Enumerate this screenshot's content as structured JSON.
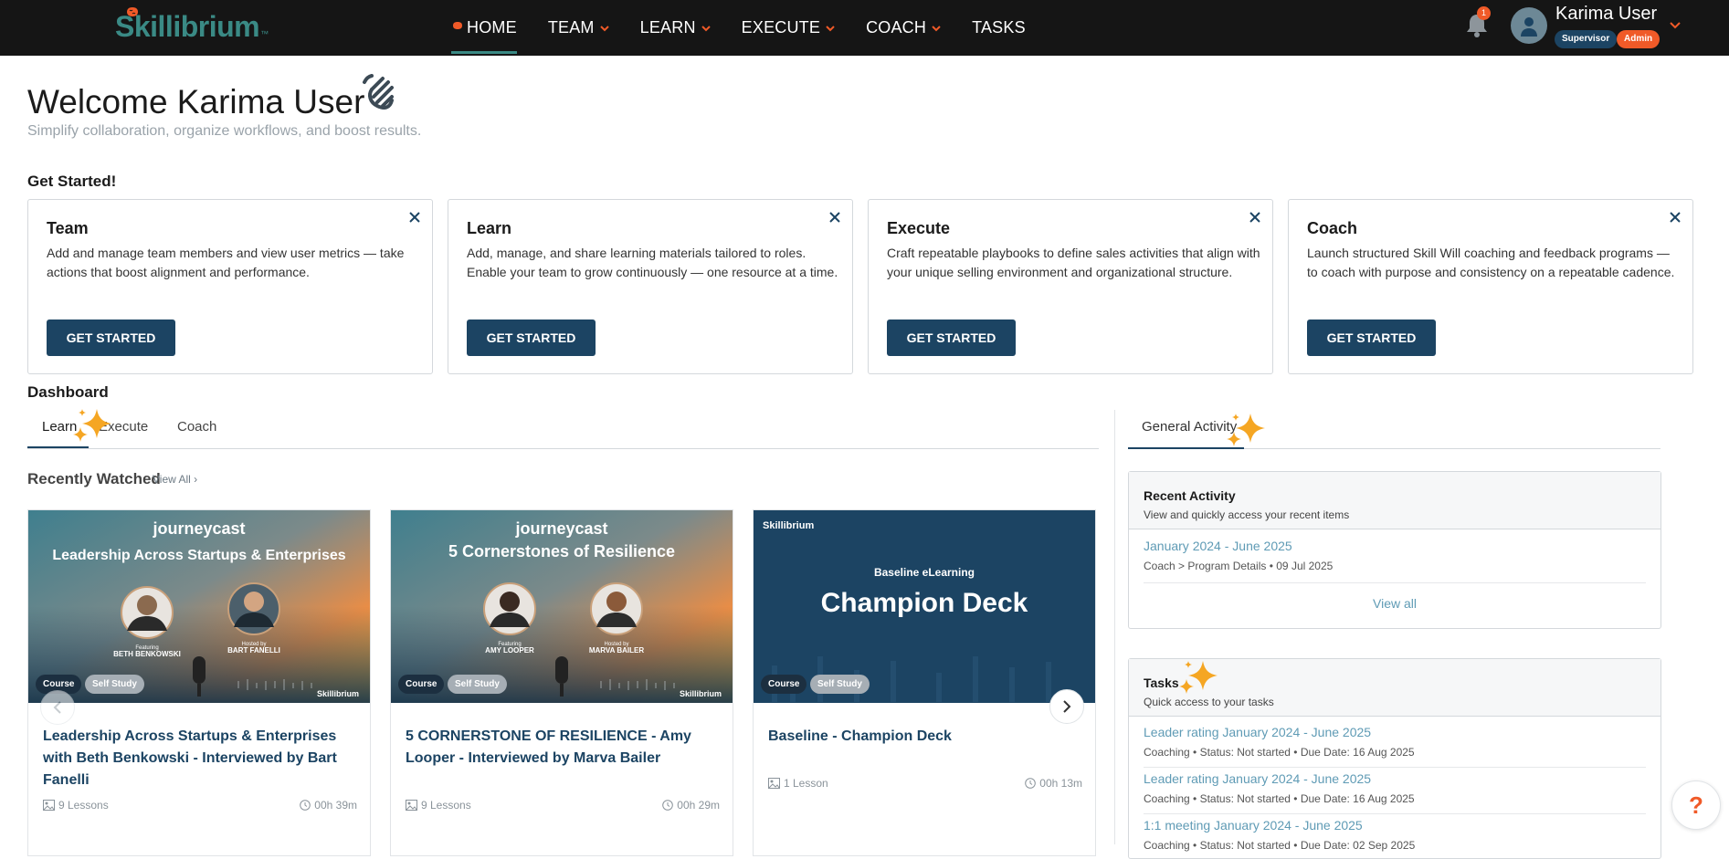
{
  "header": {
    "logo_text": "Skillibrium",
    "logo_tm": "™",
    "nav": [
      {
        "label": "HOME"
      },
      {
        "label": "TEAM"
      },
      {
        "label": "LEARN"
      },
      {
        "label": "EXECUTE"
      },
      {
        "label": "COACH"
      },
      {
        "label": "TASKS"
      }
    ],
    "notification_count": "1",
    "user_name": "Karima User",
    "roles": [
      "Supervisor",
      "Admin"
    ]
  },
  "welcome": {
    "title": "Welcome Karima User",
    "subtitle": "Simplify collaboration, organize workflows, and boost results."
  },
  "get_started": {
    "title": "Get Started!",
    "cards": [
      {
        "title": "Team",
        "text": "Add and manage team members and view user metrics —  take actions that boost alignment and performance.",
        "button": "GET STARTED"
      },
      {
        "title": "Learn",
        "text": "Add, manage, and share learning materials tailored to roles. Enable your team to grow continuously — one resource at a time.",
        "button": "GET STARTED"
      },
      {
        "title": "Execute",
        "text": "Craft repeatable playbooks to define sales activities that align with your unique selling environment and organizational structure.",
        "button": "GET STARTED"
      },
      {
        "title": "Coach",
        "text": "Launch structured Skill Will coaching and feedback programs — to coach with purpose and consistency on a repeatable cadence.",
        "button": "GET STARTED"
      }
    ]
  },
  "dashboard": {
    "title": "Dashboard",
    "tabs": [
      {
        "label": "Learn"
      },
      {
        "label": "Execute"
      },
      {
        "label": "Coach"
      }
    ],
    "recently_watched": {
      "title": "Recently Watched",
      "view_all": "View All"
    },
    "courses": [
      {
        "thumb_brand": "journeycast",
        "thumb_title": "Leadership Across Startups & Enterprises",
        "featuring_label": "Featuring",
        "featuring_name": "BETH BENKOWSKI",
        "hosted_label": "Hosted by",
        "hosted_name": "BART FANELLI",
        "watermark": "Skillibrium",
        "pills": [
          "Course",
          "Self Study"
        ],
        "title": "Leadership Across Startups & Enterprises with Beth Benkowski - Interviewed by Bart Fanelli",
        "lessons": "9 Lessons",
        "duration": "00h 39m"
      },
      {
        "thumb_brand": "journeycast",
        "thumb_title": "5 Cornerstones of Resilience",
        "featuring_label": "Featuring",
        "featuring_name": "AMY LOOPER",
        "hosted_label": "Hosted by",
        "hosted_name": "MARVA BAILER",
        "watermark": "Skillibrium",
        "pills": [
          "Course",
          "Self Study"
        ],
        "title": "5 CORNERSTONE OF RESILIENCE - Amy Looper - Interviewed by Marva Bailer",
        "lessons": "9 Lessons",
        "duration": "00h 29m"
      },
      {
        "thumb_brand": "Skillibrium",
        "thumb_kicker": "Baseline eLearning",
        "thumb_title": "Champion Deck",
        "pills": [
          "Course",
          "Self Study"
        ],
        "title": "Baseline - Champion Deck",
        "lessons": "1 Lesson",
        "duration": "00h 13m"
      }
    ]
  },
  "right": {
    "tab": "General Activity",
    "recent_activity": {
      "title": "Recent Activity",
      "subtitle": "View and quickly access your recent items",
      "items": [
        {
          "title": "January 2024 - June 2025",
          "meta": "Coach > Program Details • 09 Jul 2025"
        }
      ],
      "view_all": "View all"
    },
    "tasks": {
      "title": "Tasks",
      "subtitle": "Quick access to your tasks",
      "items": [
        {
          "title": "Leader rating January 2024 - June 2025",
          "meta": "Coaching • Status: Not started • Due Date: 16 Aug 2025"
        },
        {
          "title": "Leader rating January 2024 - June 2025",
          "meta": "Coaching • Status: Not started • Due Date: 16 Aug 2025"
        },
        {
          "title": "1:1 meeting January 2024 - June 2025",
          "meta": "Coaching • Status: Not started • Due Date: 02 Sep 2025"
        }
      ]
    }
  },
  "help_label": "?",
  "colors": {
    "nav_bg": "#151515",
    "brand_teal": "#3a8a85",
    "primary_navy": "#1c4463",
    "accent_orange": "#f05a28",
    "link_blue": "#5f9bb5"
  }
}
